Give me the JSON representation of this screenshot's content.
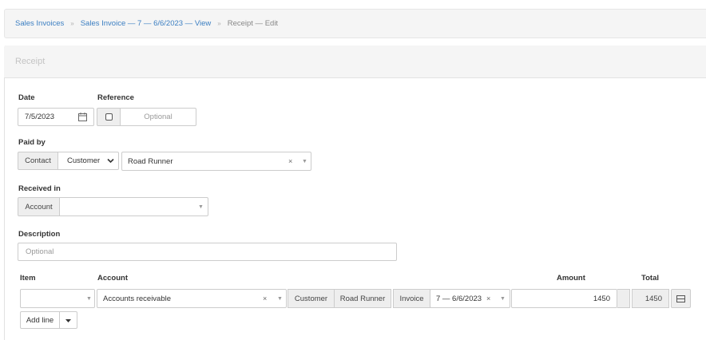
{
  "breadcrumb": {
    "items": [
      {
        "label": "Sales Invoices",
        "link": true
      },
      {
        "label": "Sales Invoice — 7 — 6/6/2023 — View",
        "link": true
      },
      {
        "label": "Receipt — Edit",
        "link": false
      }
    ],
    "separator": "»"
  },
  "panel": {
    "title": "Receipt"
  },
  "form": {
    "date": {
      "label": "Date",
      "value": "7/5/2023"
    },
    "reference": {
      "label": "Reference",
      "placeholder": "Optional",
      "checked": false
    },
    "paid_by": {
      "label": "Paid by",
      "contact_addon": "Contact",
      "contact_type": "Customer",
      "contact_value": "Road Runner"
    },
    "received_in": {
      "label": "Received in",
      "account_addon": "Account",
      "value": ""
    },
    "description": {
      "label": "Description",
      "placeholder": "Optional"
    }
  },
  "lines": {
    "headers": {
      "item": "Item",
      "account": "Account",
      "amount": "Amount",
      "total": "Total"
    },
    "rows": [
      {
        "item": "",
        "account": "Accounts receivable",
        "customer_addon": "Customer",
        "customer_value": "Road Runner",
        "invoice_addon": "Invoice",
        "invoice_value": "7 — 6/6/2023",
        "amount": "1450",
        "total": "1450"
      }
    ],
    "add_line_label": "Add line"
  },
  "icons": {
    "calendar": "calendar-icon",
    "clear": "clear-icon",
    "dropdown": "dropdown-caret-icon",
    "select_chevron": "chevron-down-icon",
    "table": "table-icon"
  },
  "colors": {
    "link": "#3c7fc2",
    "addon_bg": "#eeeeee",
    "border": "#cccccc",
    "header_bg": "#f5f5f5"
  }
}
